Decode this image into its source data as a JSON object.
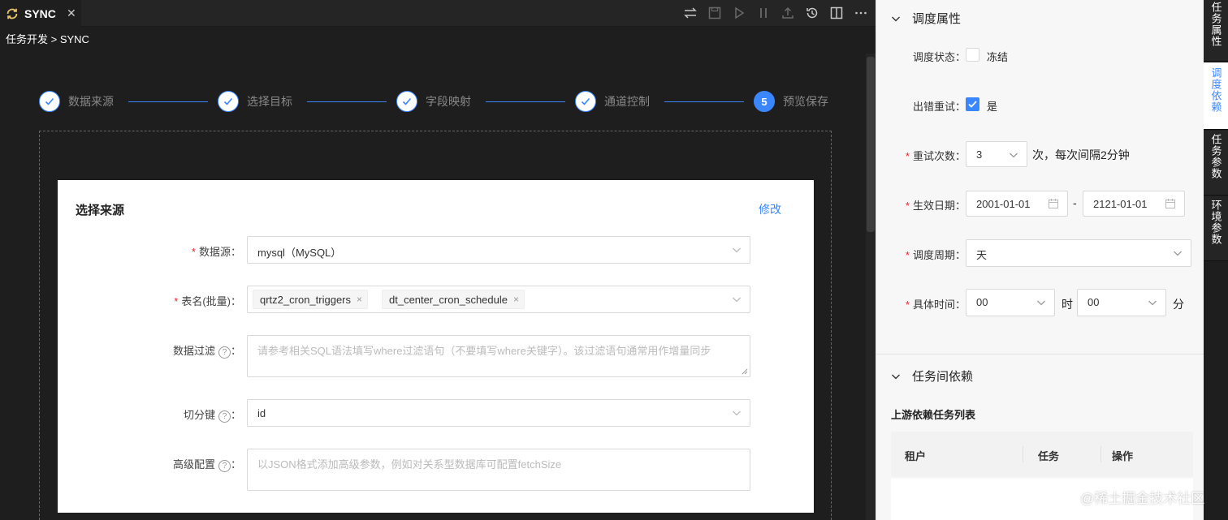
{
  "tab": {
    "title": "SYNC",
    "close": "✕"
  },
  "breadcrumb": "任务开发 > SYNC",
  "toolbar": [
    "swap-icon",
    "save-icon",
    "run-icon",
    "pause-icon",
    "upload-icon",
    "history-icon",
    "split-icon",
    "more-icon"
  ],
  "steps": [
    {
      "label": "数据来源",
      "state": "done"
    },
    {
      "label": "选择目标",
      "state": "done"
    },
    {
      "label": "字段映射",
      "state": "done"
    },
    {
      "label": "通道控制",
      "state": "done"
    },
    {
      "label": "预览保存",
      "state": "active",
      "number": "5"
    }
  ],
  "card": {
    "title": "选择来源",
    "edit": "修改",
    "fields": {
      "datasource": {
        "label": "数据源",
        "value": "mysql（MySQL）",
        "required": "*"
      },
      "table": {
        "label": "表名(批量)",
        "required": "*",
        "tags": [
          "qrtz2_cron_triggers",
          "dt_center_cron_schedule"
        ],
        "tag_close": "×"
      },
      "filter": {
        "label": "数据过滤",
        "placeholder": "请参考相关SQL语法填写where过滤语句（不要填写where关键字）。该过滤语句通常用作增量同步"
      },
      "split": {
        "label": "切分键",
        "value": "id"
      },
      "advanced": {
        "label": "高级配置",
        "placeholder": "以JSON格式添加高级参数，例如对关系型数据库可配置fetchSize"
      }
    },
    "colon": "：",
    "help": "?"
  },
  "panel": {
    "section1": "调度属性",
    "status": {
      "label": "调度状态：",
      "option": "冻结"
    },
    "retry": {
      "label": "出错重试：",
      "option": "是"
    },
    "retry_count": {
      "label": "重试次数：",
      "value": "3",
      "suffix": "次，每次间隔2分钟"
    },
    "effective": {
      "label": "生效日期：",
      "start": "2001-01-01",
      "sep": "-",
      "end": "2121-01-01"
    },
    "cycle": {
      "label": "调度周期：",
      "value": "天"
    },
    "time": {
      "label": "具体时间：",
      "hour": "00",
      "hour_unit": "时",
      "minute": "00",
      "minute_unit": "分"
    },
    "required": "*",
    "section2": "任务间依赖",
    "upstream_title": "上游依赖任务列表",
    "columns": [
      "租户",
      "任务",
      "操作"
    ]
  },
  "side_tabs": [
    {
      "label": "任务属性",
      "active": false
    },
    {
      "label": "调度依赖",
      "active": true
    },
    {
      "label": "任务参数",
      "active": false
    },
    {
      "label": "环境参数",
      "active": false
    }
  ],
  "watermark": "@稀土掘金技术社区",
  "colors": {
    "accent": "#3a86ff",
    "dark_bg": "#1e1e1e",
    "required": "#f5222d"
  }
}
